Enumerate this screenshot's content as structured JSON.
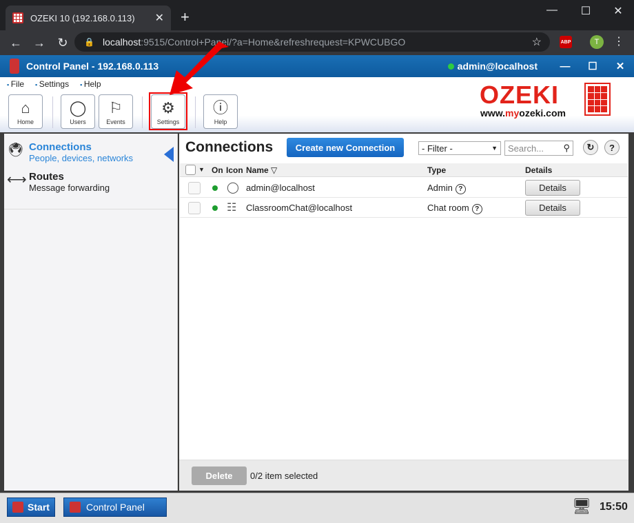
{
  "browser": {
    "tab_title": "OZEKI 10 (192.168.0.113)",
    "tab_close": "✕",
    "new_tab": "+",
    "url_host": "localhost",
    "url_path": ":9515/Control+Panel/?a=Home&refreshrequest=KPWCUBGO",
    "abp_label": "ABP",
    "profile_initial": "T"
  },
  "app": {
    "title": "Control Panel - 192.168.0.113",
    "user": "admin@localhost"
  },
  "menu": [
    "File",
    "Settings",
    "Help"
  ],
  "ribbon": {
    "home": "Home",
    "users": "Users",
    "events": "Events",
    "settings": "Settings",
    "help": "Help"
  },
  "brand": {
    "logo_text": "OZEKI",
    "url_prefix": "www.",
    "url_accent": "my",
    "url_rest": "ozeki.com"
  },
  "sidebar": {
    "items": [
      {
        "title": "Connections",
        "subtitle": "People, devices, networks"
      },
      {
        "title": "Routes",
        "subtitle": "Message forwarding"
      }
    ]
  },
  "main": {
    "heading": "Connections",
    "create_button": "Create new Connection",
    "filter": "- Filter -",
    "search_placeholder": "Search...",
    "columns": {
      "on": "On",
      "icon": "Icon",
      "name": "Name",
      "type": "Type",
      "details": "Details"
    },
    "rows": [
      {
        "name": "admin@localhost",
        "type": "Admin",
        "details": "Details",
        "online": true
      },
      {
        "name": "ClassroomChat@localhost",
        "type": "Chat room",
        "details": "Details",
        "online": true
      }
    ],
    "delete_button": "Delete",
    "selection_info": "0/2 item selected"
  },
  "taskbar": {
    "start": "Start",
    "control_panel": "Control Panel",
    "clock": "15:50"
  },
  "colors": {
    "accent": "#1a6fb5",
    "brand_red": "#e2231a",
    "highlight": "#ee0000",
    "online": "#1e9d2f"
  }
}
